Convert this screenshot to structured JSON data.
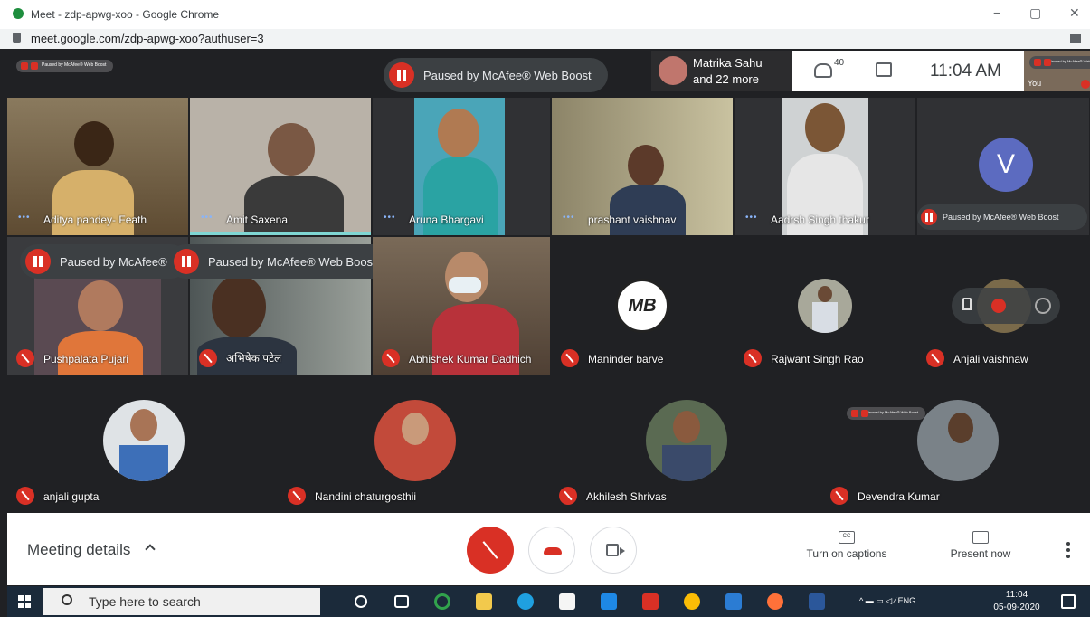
{
  "browser": {
    "title": "Meet - zdp-apwg-xoo - Google Chrome",
    "url": "meet.google.com/zdp-apwg-xoo?authuser=3",
    "minimize": "−",
    "maximize": "▢",
    "close": "✕"
  },
  "top_bar": {
    "mini_paused": "Paused by McAfee® Web Boost",
    "paused_banner": "Paused by McAfee® Web Boost",
    "participants_line1": "Matrika Sahu",
    "participants_line2": "and 22 more",
    "people_count": "40",
    "time": "11:04 AM",
    "self_label": "You"
  },
  "tiles": [
    {
      "name": "Aditya pandey- Feath",
      "mic": "speaking"
    },
    {
      "name": "Amit Saxena",
      "mic": "speaking"
    },
    {
      "name": "Aruna Bhargavi",
      "mic": "speaking"
    },
    {
      "name": "prashant vaishnav",
      "mic": "speaking"
    },
    {
      "name": "Aadrsh Singh thakur",
      "mic": "speaking"
    },
    {
      "name": "",
      "letter": "V",
      "paused": "Paused by McAfee® Web Boost"
    },
    {
      "name": "Pushpalata Pujari",
      "mic": "muted",
      "paused": "Paused by McAfee® \\"
    },
    {
      "name": "अभिषेक पटेल",
      "mic": "muted",
      "paused": "Paused by McAfee® Web Boost"
    },
    {
      "name": "Abhishek Kumar Dadhich",
      "mic": "muted"
    },
    {
      "name": "Maninder barve",
      "mic": "muted",
      "logo": "MB"
    },
    {
      "name": "Rajwant Singh Rao",
      "mic": "muted"
    },
    {
      "name": "Anjali vaishnaw",
      "mic": "muted"
    },
    {
      "name": "anjali gupta",
      "mic": "muted"
    },
    {
      "name": "Nandini chaturgosthii",
      "mic": "muted"
    },
    {
      "name": "Akhilesh Shrivas",
      "mic": "muted"
    },
    {
      "name": "Devendra Kumar",
      "mic": "muted",
      "paused": "Paused by McAfee® Web Boost"
    }
  ],
  "bottom_bar": {
    "meeting_details": "Meeting details",
    "captions_icon": "CC",
    "captions_label": "Turn on captions",
    "present_label": "Present now"
  },
  "taskbar": {
    "search_placeholder": "Type here to search",
    "tray_lang": "ENG",
    "clock_time": "11:04",
    "clock_date": "05-09-2020"
  },
  "colors": {
    "meet_bg": "#202124",
    "red": "#d93025",
    "taskbar": "#1b2a3a"
  }
}
